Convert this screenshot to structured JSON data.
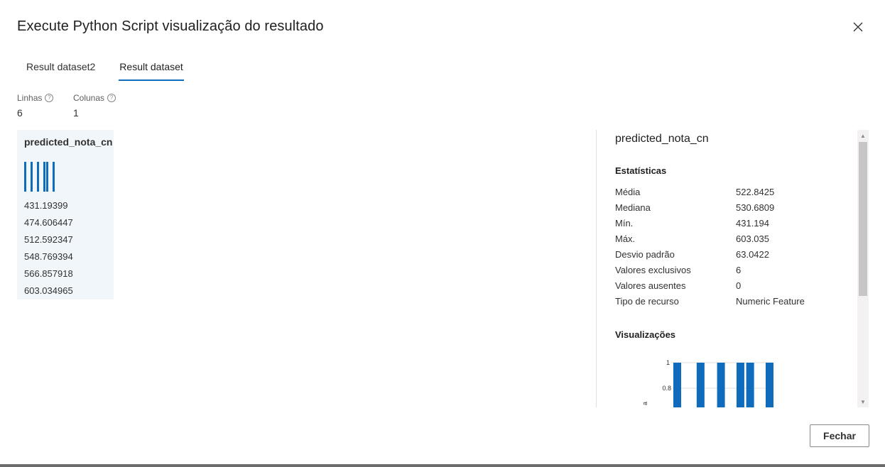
{
  "dialog": {
    "title": "Execute Python Script visualização do resultado",
    "close_icon": "close-icon"
  },
  "tabs": [
    {
      "label": "Result dataset2",
      "active": false
    },
    {
      "label": "Result dataset",
      "active": true
    }
  ],
  "summary": {
    "rows_label": "Linhas",
    "rows_value": "6",
    "cols_label": "Colunas",
    "cols_value": "1",
    "help_icon": "help-circle-icon"
  },
  "column": {
    "header": "predicted_nota_cn",
    "values": [
      "431.19399",
      "474.606447",
      "512.592347",
      "548.769394",
      "566.857918",
      "603.034965"
    ]
  },
  "panel": {
    "title": "predicted_nota_cn",
    "stats_title": "Estatísticas",
    "stats": [
      {
        "key": "Média",
        "value": "522.8425"
      },
      {
        "key": "Mediana",
        "value": "530.6809"
      },
      {
        "key": "Mín.",
        "value": "431.194"
      },
      {
        "key": "Máx.",
        "value": "603.035"
      },
      {
        "key": "Desvio padrão",
        "value": "63.0422"
      },
      {
        "key": "Valores exclusivos",
        "value": "6"
      },
      {
        "key": "Valores ausentes",
        "value": "0"
      },
      {
        "key": "Tipo de recurso",
        "value": "Numeric Feature"
      }
    ],
    "viz_title": "Visualizações"
  },
  "chart_data": {
    "type": "bar",
    "x": [
      431.194,
      474.606,
      512.592,
      548.769,
      566.858,
      603.035
    ],
    "values": [
      1,
      1,
      1,
      1,
      1,
      1
    ],
    "yticks": [
      "1",
      "0.8"
    ],
    "ylabel_fragment": "a",
    "color": "#0f6cbd"
  },
  "footer": {
    "close_label": "Fechar"
  },
  "colors": {
    "accent": "#0f6cbd",
    "card_bg": "#f1f6fb"
  }
}
